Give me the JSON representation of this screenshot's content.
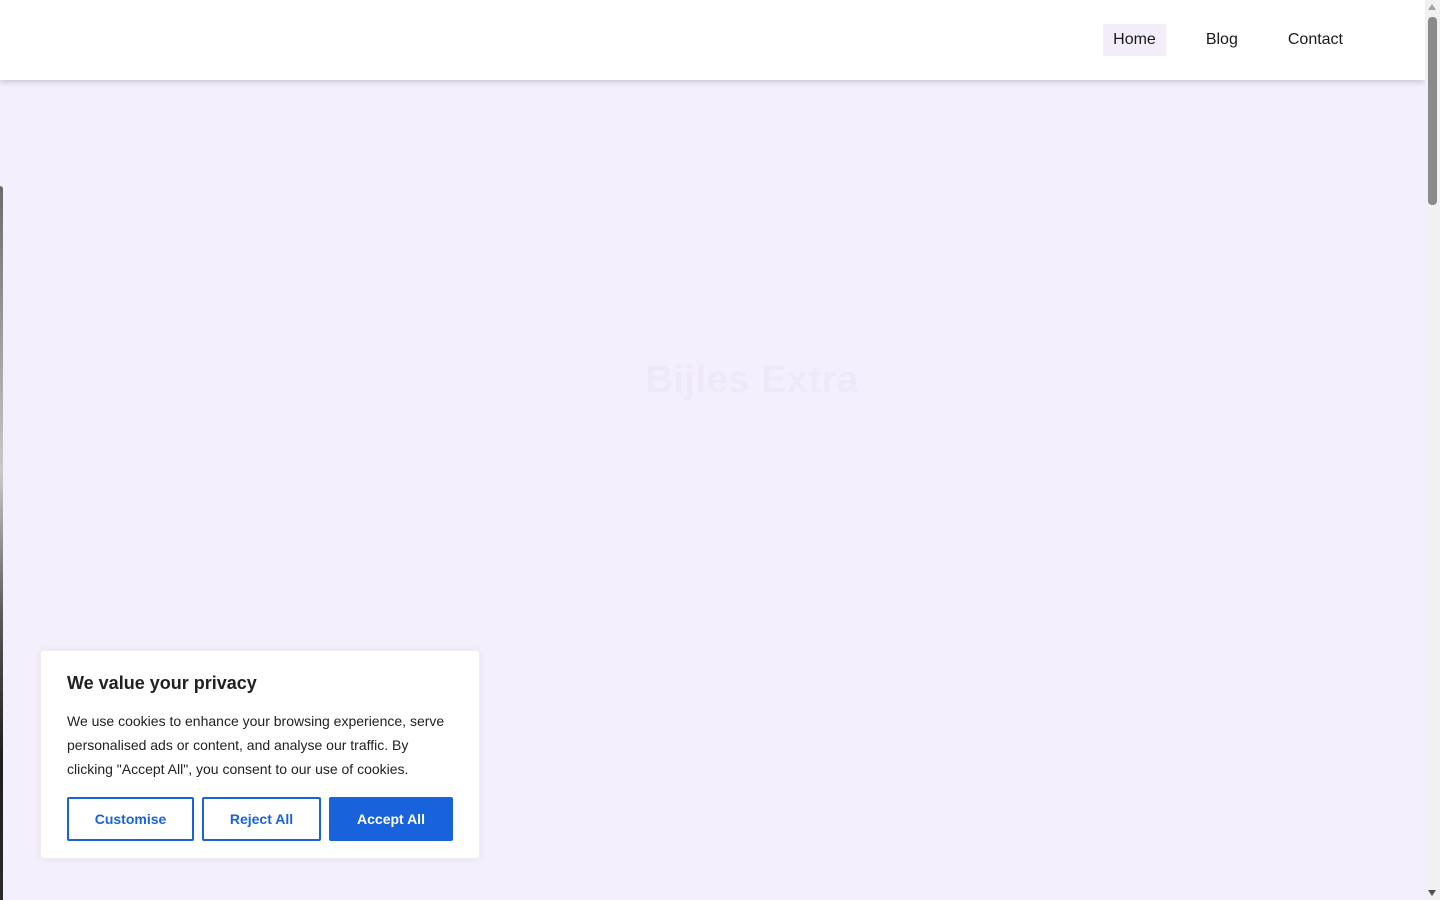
{
  "nav": {
    "items": [
      {
        "label": "Home",
        "active": true
      },
      {
        "label": "Blog",
        "active": false
      },
      {
        "label": "Contact",
        "active": false
      }
    ]
  },
  "hero": {
    "title": "Bijles Extra"
  },
  "cookie_banner": {
    "title": "We value your privacy",
    "text": "We use cookies to enhance your browsing experience, serve personalised ads or content, and analyse our traffic. By clicking \"Accept All\", you consent to our use of cookies.",
    "customise_label": "Customise",
    "reject_label": "Reject All",
    "accept_label": "Accept All"
  },
  "colors": {
    "page_background": "#f4effd",
    "accent": "#1863dc",
    "nav_active_background": "#f3ecfb"
  }
}
